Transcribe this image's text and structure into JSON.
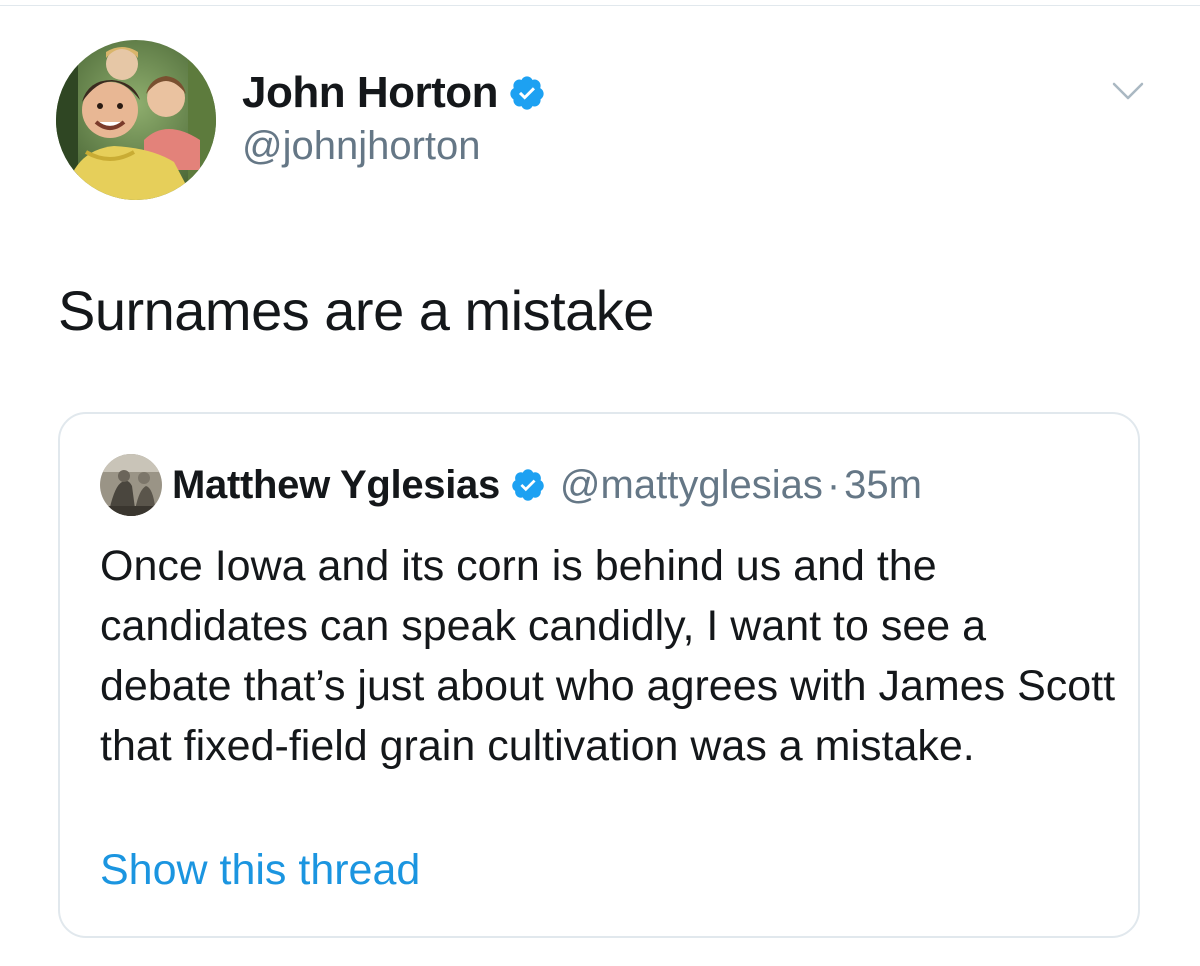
{
  "tweet": {
    "author": {
      "name": "John Horton",
      "handle": "@johnjhorton",
      "verified": true
    },
    "text": "Surnames are a mistake",
    "menu_icon": "chevron-down-icon"
  },
  "quote": {
    "author": {
      "name": "Matthew Yglesias",
      "handle": "@mattyglesias",
      "verified": true
    },
    "separator": "·",
    "time": "35m",
    "text": "Once Iowa and its corn is behind us and the candidates can speak candidly, I want to see a debate that’s just about who agrees with James Scott that fixed-field grain cultivation was a mistake.",
    "show_thread": "Show this thread"
  },
  "colors": {
    "text_primary": "#14171a",
    "text_secondary": "#657786",
    "link": "#1b95e0",
    "verified": "#1da1f2",
    "border": "#e1e8ed"
  }
}
